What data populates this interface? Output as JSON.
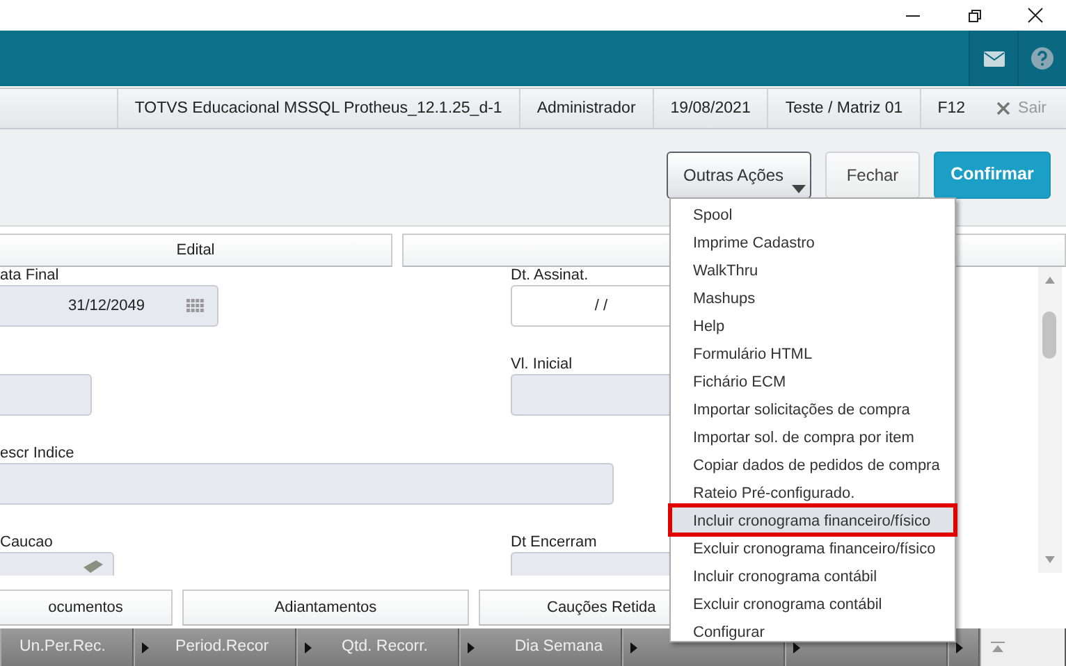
{
  "info_bar": {
    "items": [
      "TOTVS Educacional MSSQL Protheus_12.1.25_d-1",
      "Administrador",
      "19/08/2021",
      "Teste / Matriz 01",
      "F12"
    ],
    "exit": "Sair"
  },
  "actions": [
    {
      "label": "Outras Ações",
      "kind": "dropdown"
    },
    {
      "label": "Fechar",
      "kind": "plain"
    },
    {
      "label": "Confirmar",
      "kind": "primary"
    }
  ],
  "top_tabs": [
    {
      "label": "Edital"
    }
  ],
  "form_rows": [
    [
      {
        "label": "ata Final",
        "value": "31/12/2049",
        "kind": "date",
        "disabled": true
      },
      {
        "label": "Dt. Assinat.",
        "value": "/ /",
        "kind": "text",
        "disabled": false
      }
    ],
    [
      {
        "kind": "text",
        "disabled": true
      },
      {
        "label": "Vl. Inicial",
        "kind": "text",
        "disabled": true
      }
    ],
    [
      {
        "label": "escr Indice",
        "kind": "text",
        "disabled": true
      }
    ],
    [
      {
        "label": "Caucao",
        "kind": "money",
        "disabled": true
      },
      {
        "label": "Dt Encerram",
        "kind": "text",
        "disabled": true
      }
    ]
  ],
  "bottom_tabs": [
    "ocumentos",
    "Adiantamentos",
    "Cauções Retida"
  ],
  "grid_columns": [
    "Un.Per.Rec.",
    "Period.Recor",
    "Qtd. Recorr.",
    "Dia Semana"
  ],
  "menu": {
    "items": [
      {
        "label": "Spool",
        "selected": false
      },
      {
        "label": "Imprime Cadastro",
        "selected": false
      },
      {
        "label": "WalkThru",
        "selected": false
      },
      {
        "label": "Mashups",
        "selected": false
      },
      {
        "label": "Help",
        "selected": false
      },
      {
        "label": "Formulário HTML",
        "selected": false
      },
      {
        "label": "Fichário ECM",
        "selected": false
      },
      {
        "label": "Importar solicitações de compra",
        "selected": false
      },
      {
        "label": "Importar sol. de compra por item",
        "selected": false
      },
      {
        "label": "Copiar dados de pedidos de compra",
        "selected": false
      },
      {
        "label": "Rateio Pré-configurado.",
        "selected": false
      },
      {
        "label": "Incluir cronograma financeiro/físico",
        "selected": true
      },
      {
        "label": "Excluir cronograma financeiro/físico",
        "selected": false
      },
      {
        "label": "Incluir cronograma contábil",
        "selected": false
      },
      {
        "label": "Excluir cronograma contábil",
        "selected": false
      },
      {
        "label": "Configurar",
        "selected": false
      }
    ]
  }
}
